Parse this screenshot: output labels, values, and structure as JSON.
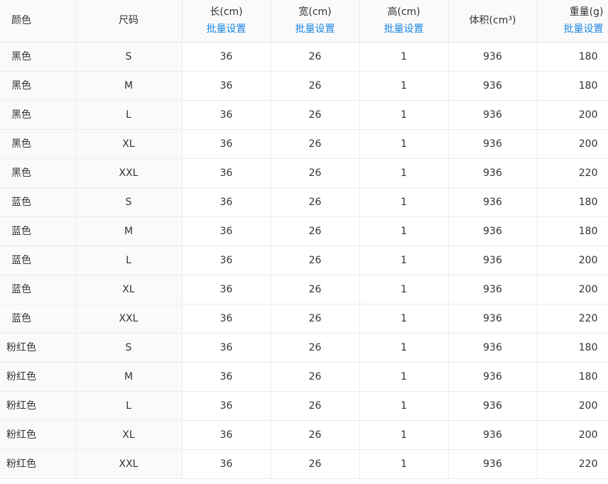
{
  "headers": {
    "color": "颜色",
    "size": "尺码",
    "length": "长(cm)",
    "width": "宽(cm)",
    "height": "高(cm)",
    "volume": "体积(cm³)",
    "weight": "重量(g)",
    "batch_label": "批量设置"
  },
  "colors": {
    "link": "#1e88e5",
    "header_bg": "#fafafa",
    "border": "#e8e8e8"
  },
  "rows": [
    {
      "color": "黑色",
      "size": "S",
      "length": "36",
      "width": "26",
      "height": "1",
      "volume": "936",
      "weight": "180"
    },
    {
      "color": "黑色",
      "size": "M",
      "length": "36",
      "width": "26",
      "height": "1",
      "volume": "936",
      "weight": "180"
    },
    {
      "color": "黑色",
      "size": "L",
      "length": "36",
      "width": "26",
      "height": "1",
      "volume": "936",
      "weight": "200"
    },
    {
      "color": "黑色",
      "size": "XL",
      "length": "36",
      "width": "26",
      "height": "1",
      "volume": "936",
      "weight": "200"
    },
    {
      "color": "黑色",
      "size": "XXL",
      "length": "36",
      "width": "26",
      "height": "1",
      "volume": "936",
      "weight": "220"
    },
    {
      "color": "蓝色",
      "size": "S",
      "length": "36",
      "width": "26",
      "height": "1",
      "volume": "936",
      "weight": "180"
    },
    {
      "color": "蓝色",
      "size": "M",
      "length": "36",
      "width": "26",
      "height": "1",
      "volume": "936",
      "weight": "180"
    },
    {
      "color": "蓝色",
      "size": "L",
      "length": "36",
      "width": "26",
      "height": "1",
      "volume": "936",
      "weight": "200"
    },
    {
      "color": "蓝色",
      "size": "XL",
      "length": "36",
      "width": "26",
      "height": "1",
      "volume": "936",
      "weight": "200"
    },
    {
      "color": "蓝色",
      "size": "XXL",
      "length": "36",
      "width": "26",
      "height": "1",
      "volume": "936",
      "weight": "220"
    },
    {
      "color": "粉红色",
      "size": "S",
      "length": "36",
      "width": "26",
      "height": "1",
      "volume": "936",
      "weight": "180"
    },
    {
      "color": "粉红色",
      "size": "M",
      "length": "36",
      "width": "26",
      "height": "1",
      "volume": "936",
      "weight": "180"
    },
    {
      "color": "粉红色",
      "size": "L",
      "length": "36",
      "width": "26",
      "height": "1",
      "volume": "936",
      "weight": "200"
    },
    {
      "color": "粉红色",
      "size": "XL",
      "length": "36",
      "width": "26",
      "height": "1",
      "volume": "936",
      "weight": "200"
    },
    {
      "color": "粉红色",
      "size": "XXL",
      "length": "36",
      "width": "26",
      "height": "1",
      "volume": "936",
      "weight": "220"
    }
  ]
}
